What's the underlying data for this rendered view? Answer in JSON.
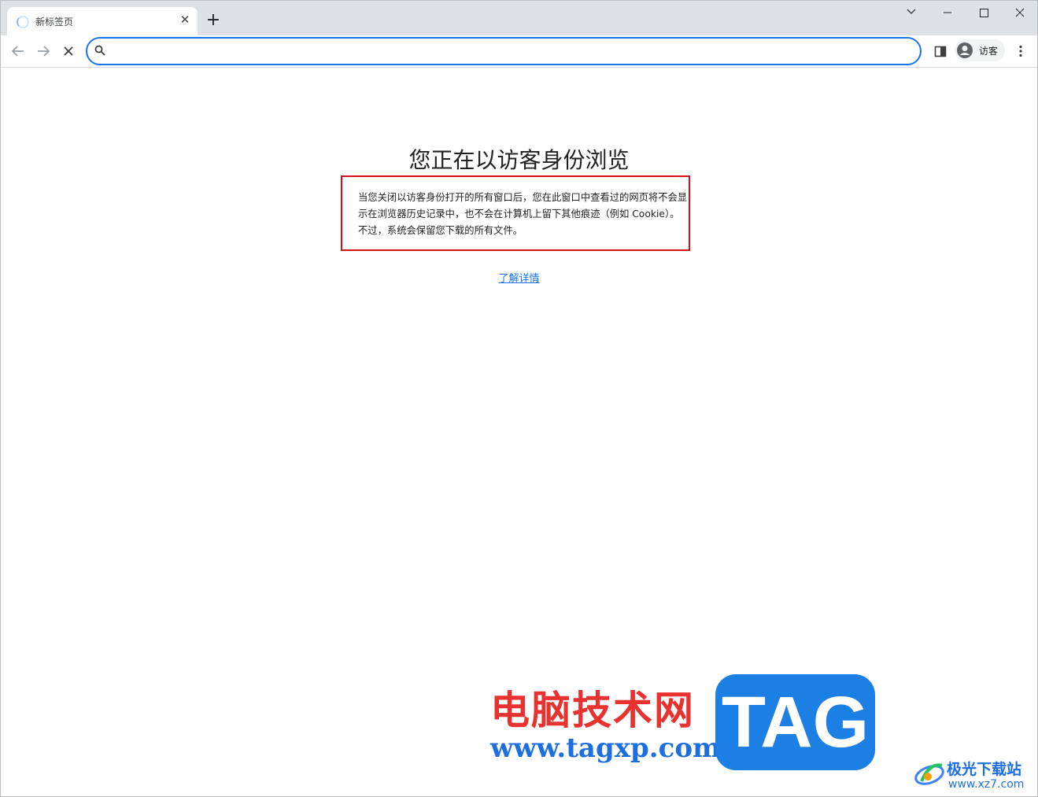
{
  "tab": {
    "title": "新标签页",
    "close": "✕"
  },
  "new_tab": "+",
  "omnibox": {
    "value": "",
    "placeholder": ""
  },
  "profile": {
    "label": "访客"
  },
  "content": {
    "heading": "您正在以访客身份浏览",
    "description": "当您关闭以访客身份打开的所有窗口后，您在此窗口中查看过的网页将不会显示在浏览器历史记录中，也不会在计算机上留下其他痕迹（例如 Cookie）。不过，系统会保留您下载的所有文件。",
    "learn_more": "了解详情"
  },
  "watermark": {
    "site_name": "电脑技术网",
    "url": "www.tagxp.com",
    "tag": "TAG",
    "corner_name": "极光下载站",
    "corner_url": "www.xz7.com"
  },
  "colors": {
    "accent": "#1a73e8",
    "highlight_border": "#d21217",
    "tab_strip": "#dee1e6"
  },
  "icons": {
    "back": "arrow-left-icon",
    "forward": "arrow-right-icon",
    "stop": "close-icon",
    "search": "search-icon",
    "side_panel": "side-panel-icon",
    "avatar": "account-circle-icon",
    "menu": "more-vert-icon"
  }
}
